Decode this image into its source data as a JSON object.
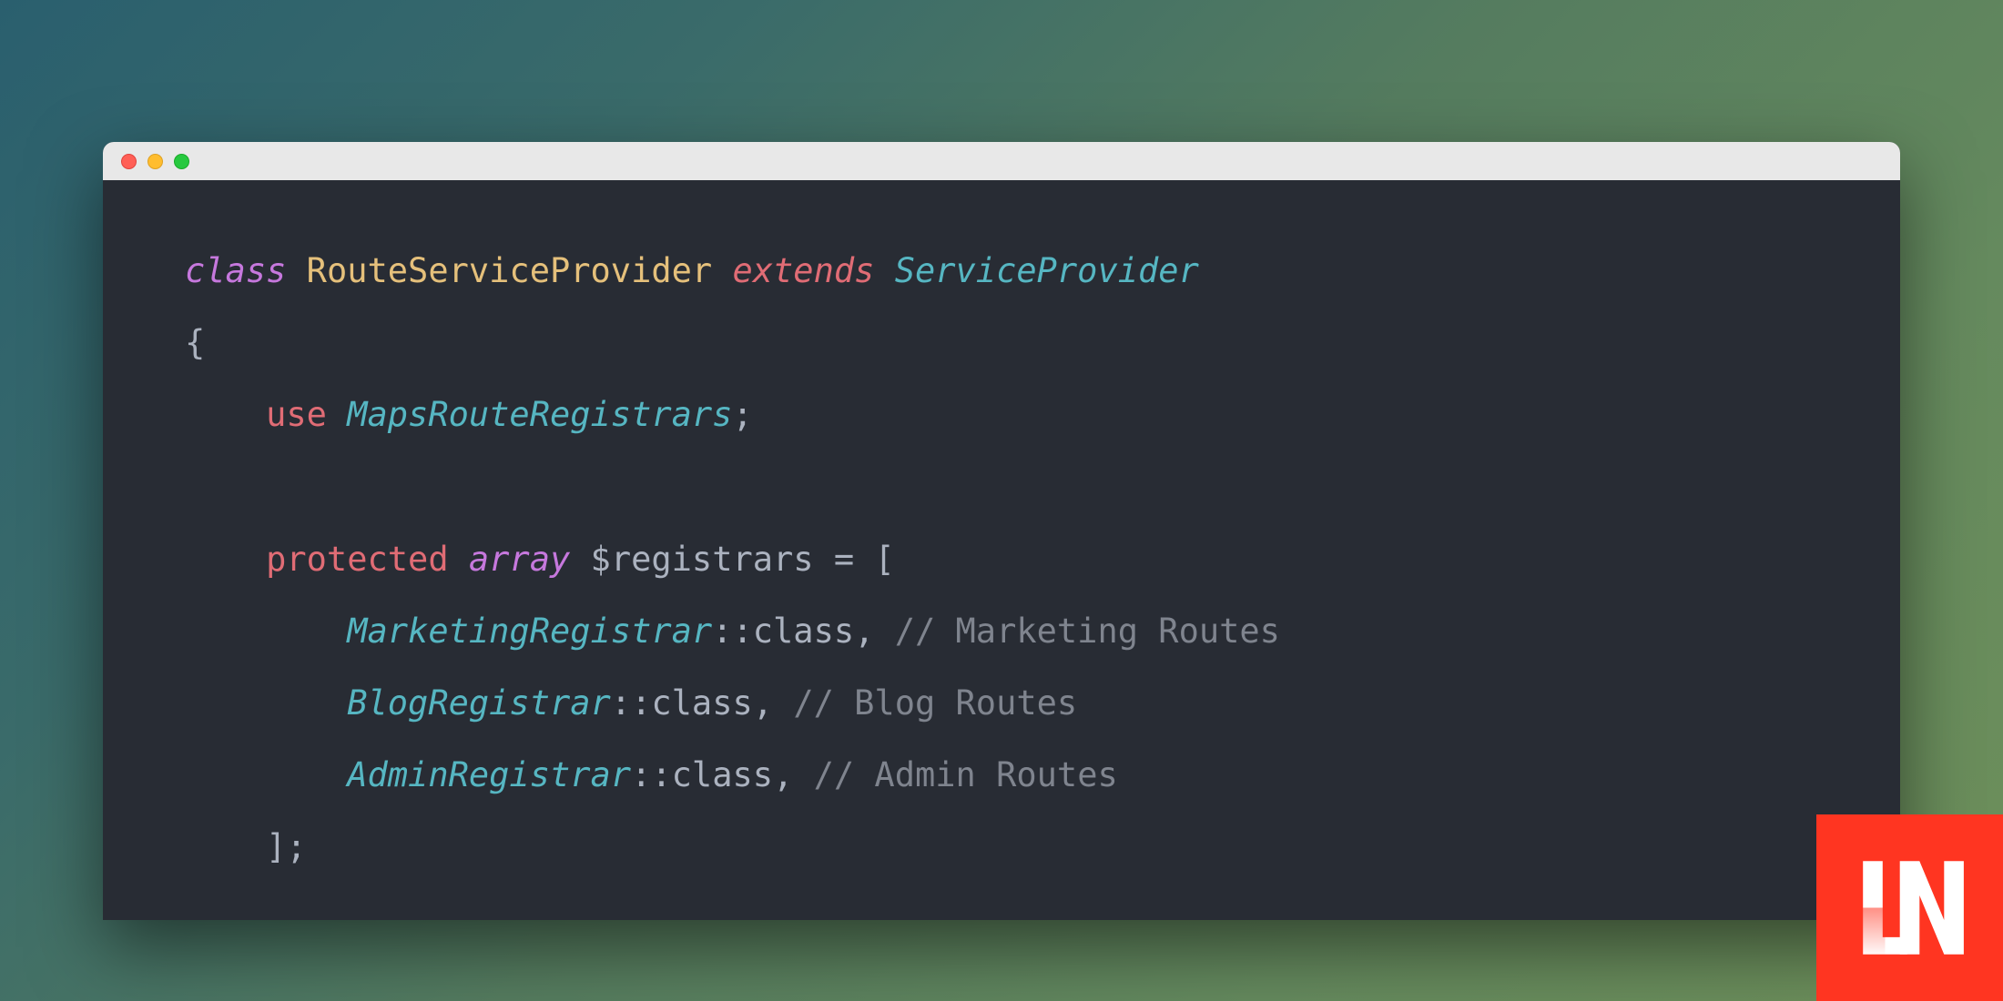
{
  "code": {
    "line1": {
      "class_kw": "class",
      "classname": "RouteServiceProvider",
      "extends_kw": "extends",
      "parent": "ServiceProvider"
    },
    "line2": {
      "brace": "{"
    },
    "line3": {
      "use_kw": "use",
      "trait": "MapsRouteRegistrars",
      "semi": ";"
    },
    "line4": {
      "protected_kw": "protected",
      "array_kw": "array",
      "var": "$registrars",
      "eq": "=",
      "bracket": "["
    },
    "line5": {
      "class_ref": "MarketingRegistrar",
      "scope": "::",
      "class_prop": "class",
      "comma": ",",
      "comment": "// Marketing Routes"
    },
    "line6": {
      "class_ref": "BlogRegistrar",
      "scope": "::",
      "class_prop": "class",
      "comma": ",",
      "comment": "// Blog Routes"
    },
    "line7": {
      "class_ref": "AdminRegistrar",
      "scope": "::",
      "class_prop": "class",
      "comma": ",",
      "comment": "// Admin Routes"
    },
    "line8": {
      "close": "];"
    }
  },
  "logo": {
    "text": "LN"
  }
}
